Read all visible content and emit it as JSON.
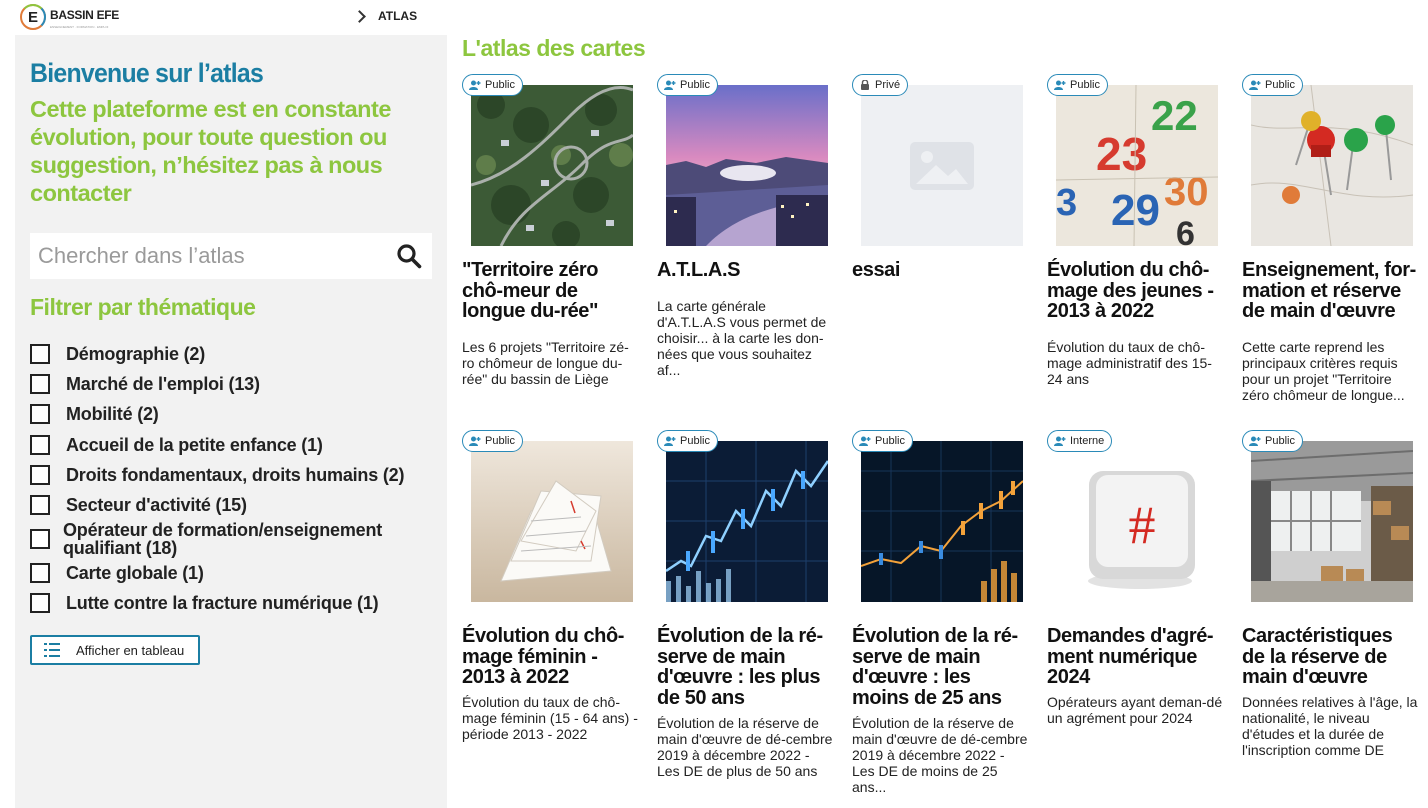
{
  "header": {
    "logo_text": "BASSIN EFE",
    "logo_sub": "ENSEIGNEMENT · FORMATION · EMPLOI",
    "breadcrumb": "ATLAS"
  },
  "sidebar": {
    "welcome": "Bienvenue sur l’atlas",
    "intro": "Cette plateforme est en constante évolution, pour toute question ou suggestion, n’hésitez pas à nous contacter",
    "search_placeholder": "Chercher dans l’atlas",
    "filter_title": "Filtrer par thématique",
    "filters": [
      {
        "label": "Démographie (2)"
      },
      {
        "label": "Marché de l'emploi (13)"
      },
      {
        "label": "Mobilité (2)"
      },
      {
        "label": "Accueil de la petite enfance (1)"
      },
      {
        "label": "Droits fondamentaux, droits humains (2)"
      },
      {
        "label": "Secteur d'activité (15)"
      },
      {
        "label": "Opérateur de formation/enseignement qualifiant (18)"
      },
      {
        "label": "Carte globale (1)"
      },
      {
        "label": "Lutte contre la fracture numérique (1)"
      }
    ],
    "table_button": "Afficher en tableau"
  },
  "main": {
    "title": "L'atlas des cartes",
    "cards": [
      {
        "badge": "Public",
        "badge_icon": "user-plus-icon",
        "image": "aerial-neighborhood",
        "title": "\"Territoire zéro chô-meur de longue du-rée\"",
        "desc": "Les 6 projets \"Territoire zé-ro chômeur de longue du-rée\" du bassin de Liège"
      },
      {
        "badge": "Public",
        "badge_icon": "user-plus-icon",
        "image": "city-sunset",
        "title": "A.T.L.A.S",
        "desc": "La carte générale d'A.T.L.A.S vous permet de choisir... à la carte les don-nées que vous souhaitez af..."
      },
      {
        "badge": "Privé",
        "badge_icon": "lock-icon",
        "image": "placeholder",
        "title": "essai",
        "desc": ""
      },
      {
        "badge": "Public",
        "badge_icon": "user-plus-icon",
        "image": "calendar",
        "title": "Évolution du chô-mage des jeunes - 2013 à 2022",
        "desc": "Évolution du taux de chô-mage administratif des 15-24 ans"
      },
      {
        "badge": "Public",
        "badge_icon": "user-plus-icon",
        "image": "push-pins",
        "title": "Enseignement, for-mation et réserve de main d'œuvre",
        "desc": "Cette carte reprend les principaux critères requis pour un projet \"Territoire zéro chômeur de longue..."
      },
      {
        "badge": "Public",
        "badge_icon": "user-plus-icon",
        "image": "crumpled-calendar",
        "title": "Évolution du chô-mage féminin - 2013 à 2022",
        "desc": "Évolution du taux de chô-mage féminin (15 - 64 ans) - période 2013 - 2022"
      },
      {
        "badge": "Public",
        "badge_icon": "user-plus-icon",
        "image": "stock-chart-blue",
        "title": "Évolution de la ré-serve de main d'œuvre : les plus de 50 ans",
        "desc": "Évolution de la réserve de main d'œuvre de dé-cembre 2019 à décembre 2022 - Les DE de plus de 50 ans"
      },
      {
        "badge": "Public",
        "badge_icon": "user-plus-icon",
        "image": "stock-chart-orange",
        "title": "Évolution de la ré-serve de main d'œuvre : les moins de 25 ans",
        "desc": "Évolution de la réserve de main d'œuvre de dé-cembre 2019 à décembre 2022 - Les DE de moins de 25 ans..."
      },
      {
        "badge": "Interne",
        "badge_icon": "user-plus-icon",
        "image": "hashtag-key",
        "title": "Demandes d'agré-ment numérique 2024",
        "desc": "Opérateurs ayant deman-dé un agrément pour 2024"
      },
      {
        "badge": "Public",
        "badge_icon": "user-plus-icon",
        "image": "warehouse",
        "title": "Caractéristiques de la réserve de main d'œuvre",
        "desc": "Données relatives à l'âge, la nationalité, le niveau d'études et la durée de l'inscription comme DE"
      }
    ]
  },
  "colors": {
    "brand_blue": "#1b7ea3",
    "brand_green": "#8dc63f",
    "sidebar_bg": "#f2f2f2"
  }
}
